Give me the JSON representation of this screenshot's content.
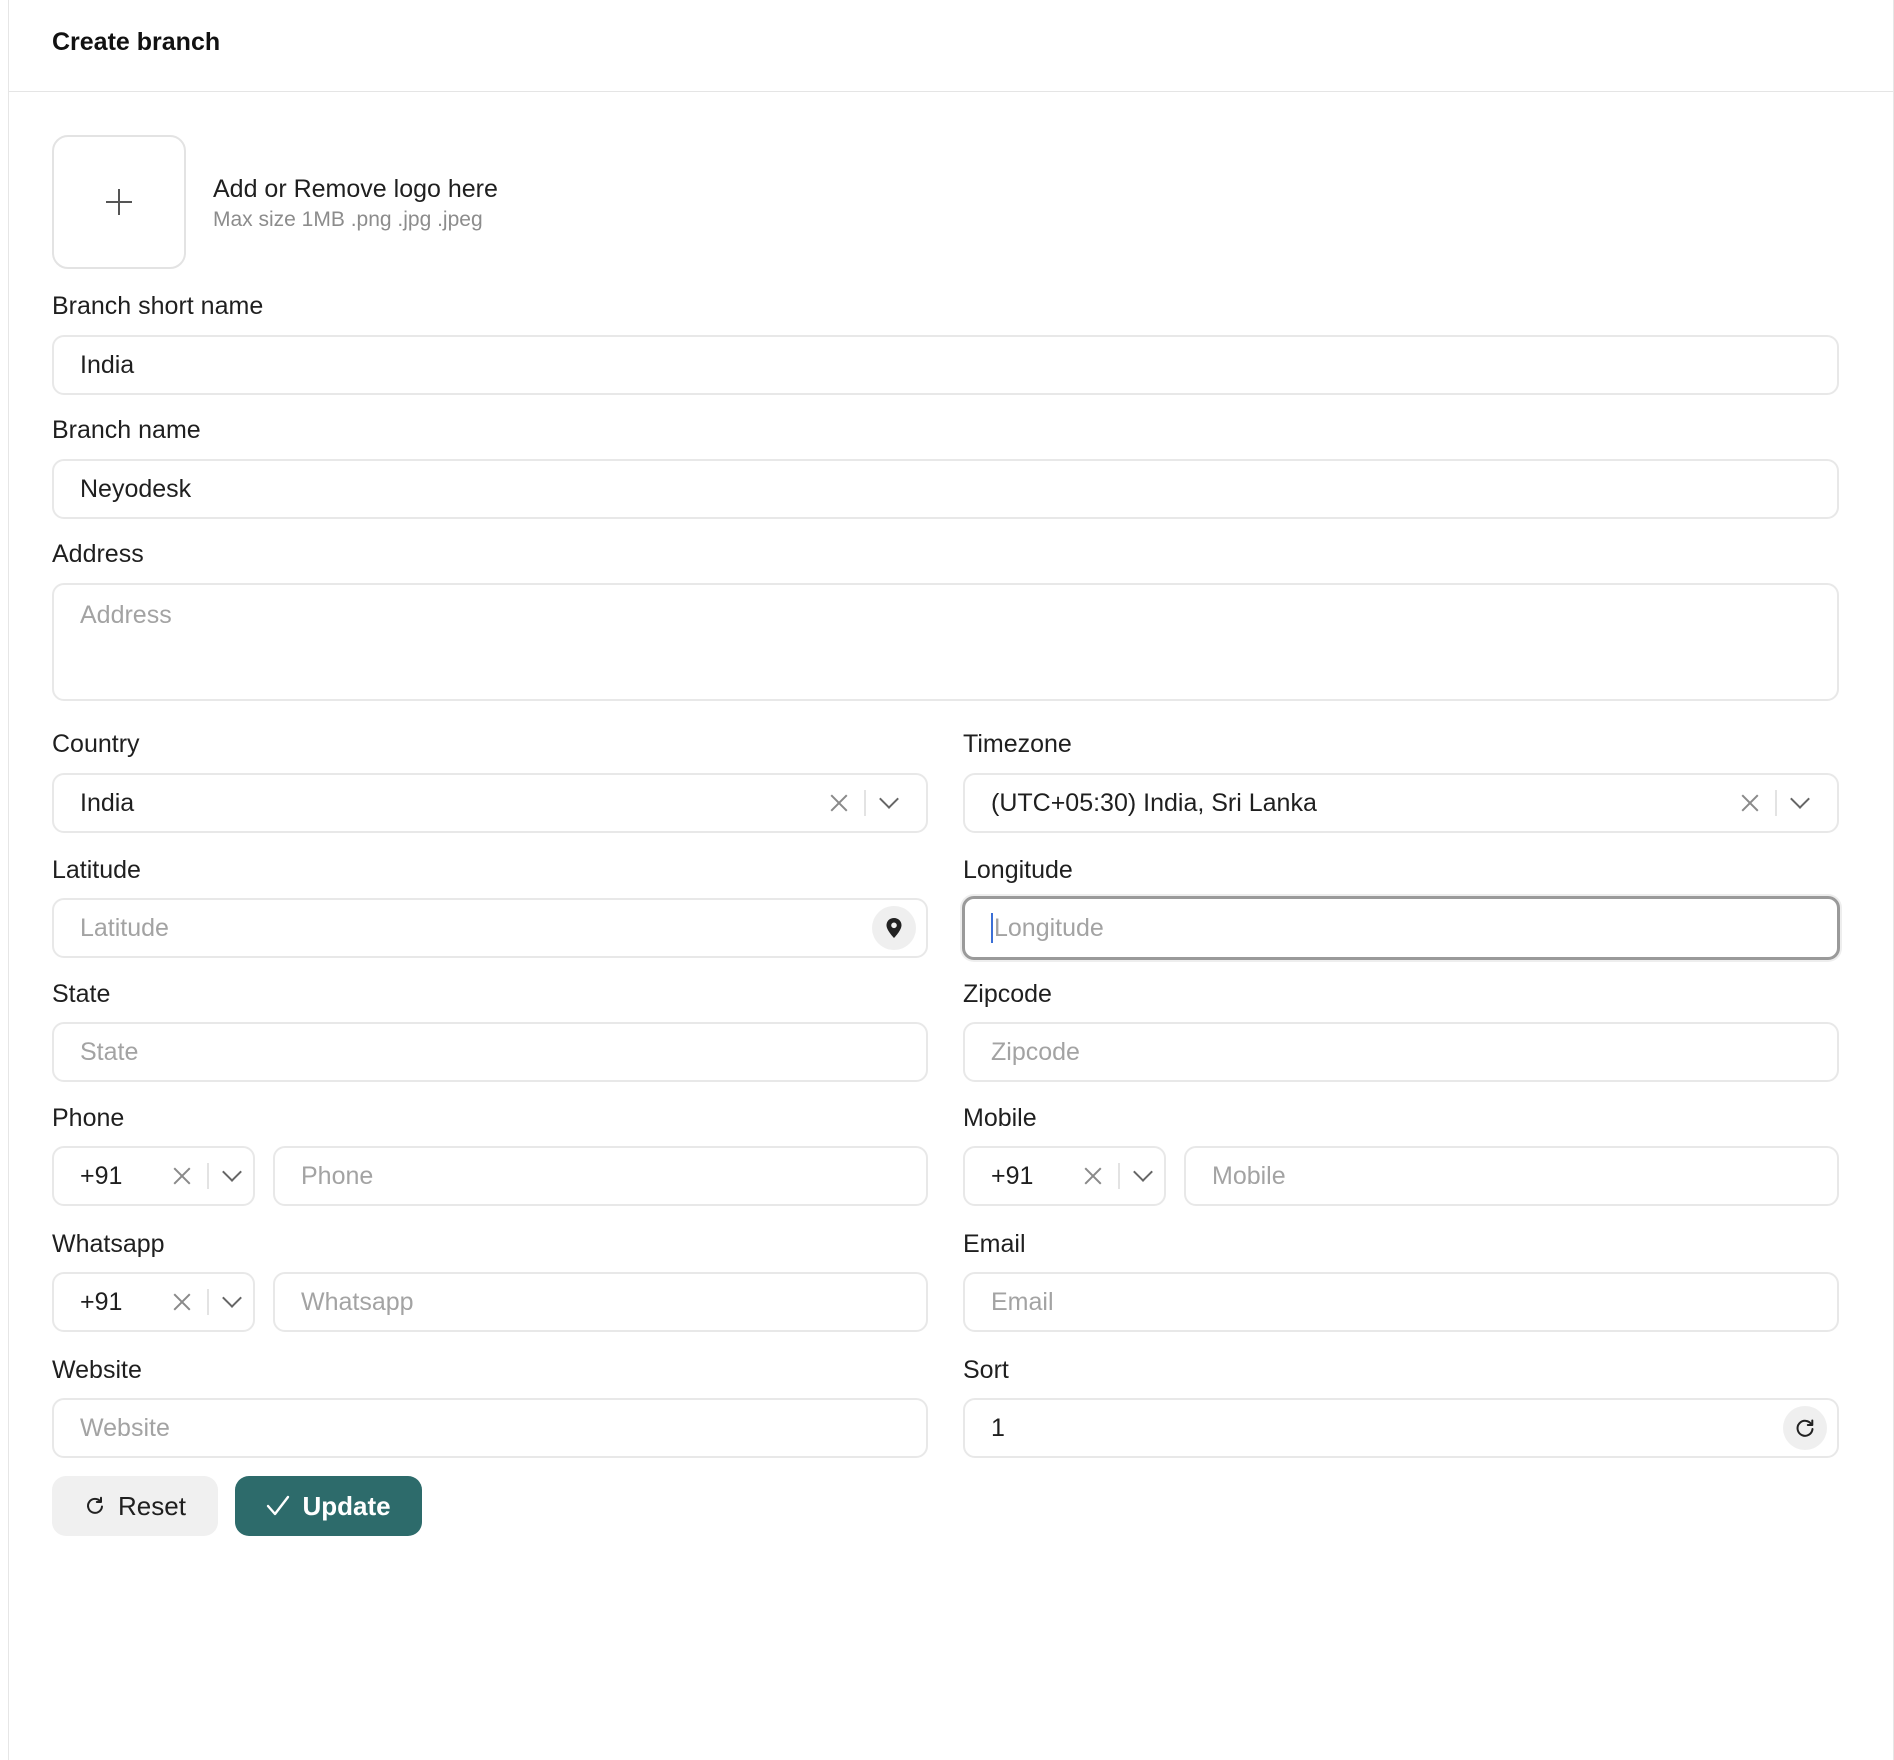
{
  "header": {
    "title": "Create branch"
  },
  "logo": {
    "title": "Add or Remove logo here",
    "hint": "Max size 1MB .png .jpg .jpeg"
  },
  "fields": {
    "branch_short_name": {
      "label": "Branch short name",
      "value": "India"
    },
    "branch_name": {
      "label": "Branch name",
      "value": "Neyodesk"
    },
    "address": {
      "label": "Address",
      "placeholder": "Address"
    },
    "country": {
      "label": "Country",
      "value": "India"
    },
    "timezone": {
      "label": "Timezone",
      "value": "(UTC+05:30) India, Sri Lanka"
    },
    "latitude": {
      "label": "Latitude",
      "placeholder": "Latitude"
    },
    "longitude": {
      "label": "Longitude",
      "placeholder": "Longitude"
    },
    "state": {
      "label": "State",
      "placeholder": "State"
    },
    "zipcode": {
      "label": "Zipcode",
      "placeholder": "Zipcode"
    },
    "phone": {
      "label": "Phone",
      "code": "+91",
      "placeholder": "Phone"
    },
    "mobile": {
      "label": "Mobile",
      "code": "+91",
      "placeholder": "Mobile"
    },
    "whatsapp": {
      "label": "Whatsapp",
      "code": "+91",
      "placeholder": "Whatsapp"
    },
    "email": {
      "label": "Email",
      "placeholder": "Email"
    },
    "website": {
      "label": "Website",
      "placeholder": "Website"
    },
    "sort": {
      "label": "Sort",
      "value": "1"
    }
  },
  "actions": {
    "reset_label": "Reset",
    "update_label": "Update"
  },
  "colors": {
    "primary": "#2d6b6b",
    "border": "#e8e8e8",
    "placeholder": "#a3a3a3"
  }
}
